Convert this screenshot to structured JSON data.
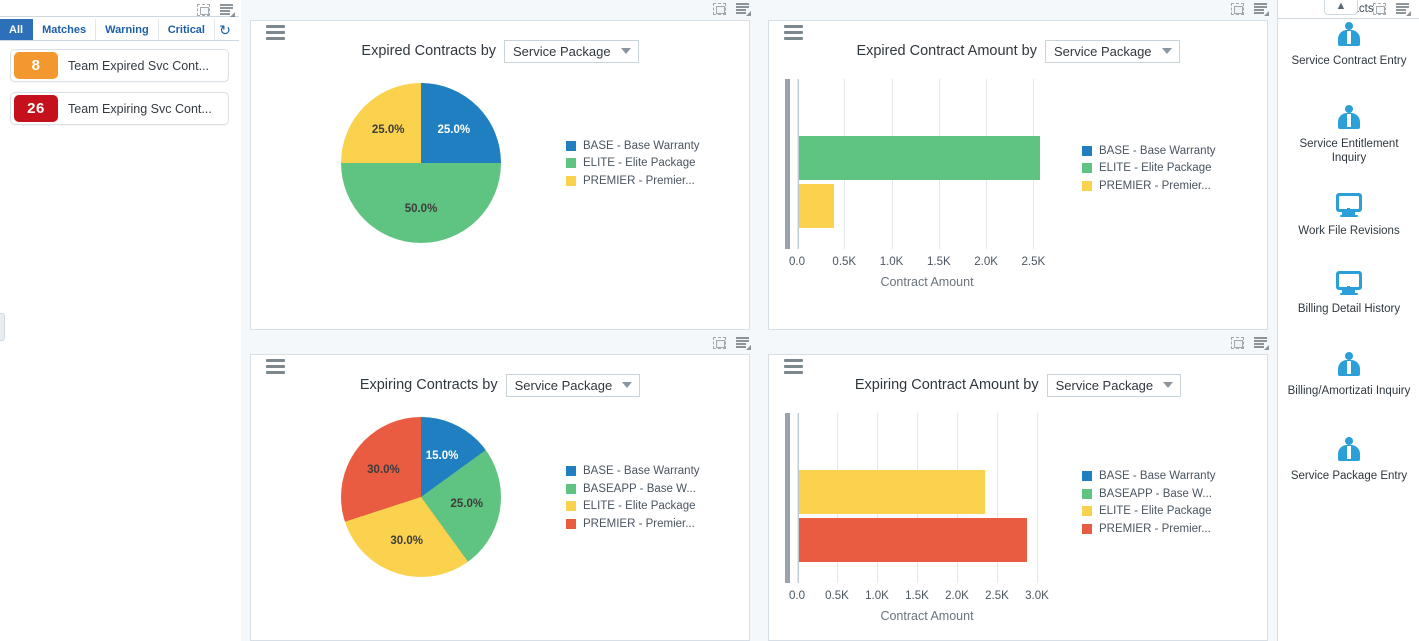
{
  "alerts_pane": {
    "tabs": [
      {
        "label": "All",
        "active": true
      },
      {
        "label": "Matches",
        "active": false
      },
      {
        "label": "Warning",
        "active": false
      },
      {
        "label": "Critical",
        "active": false
      }
    ],
    "refresh_glyph": "↻",
    "items": [
      {
        "count": "8",
        "label": "Team Expired Svc Cont...",
        "color": "#f2982f"
      },
      {
        "count": "26",
        "label": "Team Expiring Svc Cont...",
        "color": "#c4111b"
      }
    ]
  },
  "colors": {
    "base": "#1f7fc0",
    "baseapp": "#5fc481",
    "elite": "#fad24e",
    "premier": "#ea5c41",
    "elite_green": "#5fc481",
    "premier_yellow": "#fad24e"
  },
  "panels": [
    {
      "title": "Expired Contracts by",
      "dropdown": "Service Package",
      "chart_ref": 0
    },
    {
      "title": "Expired Contract Amount by",
      "dropdown": "Service Package",
      "chart_ref": 1
    },
    {
      "title": "Expiring Contracts by",
      "dropdown": "Service Package",
      "chart_ref": 2
    },
    {
      "title": "Expiring Contract Amount by",
      "dropdown": "Service Package",
      "chart_ref": 3
    }
  ],
  "chart_data": [
    {
      "type": "pie",
      "title": "Expired Contracts by Service Package",
      "categories": [
        "BASE - Base Warranty",
        "ELITE - Elite Package",
        "PREMIER - Premier..."
      ],
      "values": [
        25.0,
        50.0,
        25.0
      ],
      "data_labels": [
        "25.0%",
        "50.0%",
        "25.0%"
      ],
      "colors": [
        "#1f7fc0",
        "#5fc481",
        "#fad24e"
      ],
      "legend": [
        "BASE - Base Warranty",
        "ELITE - Elite Package",
        "PREMIER - Premier..."
      ],
      "legend_position": "right",
      "xlabel": "",
      "ylabel": ""
    },
    {
      "type": "bar",
      "orientation": "horizontal",
      "title": "Expired Contract Amount by Service Package",
      "categories": [
        "ELITE - Elite Package",
        "PREMIER - Premier..."
      ],
      "values": [
        2550,
        370
      ],
      "colors": [
        "#5fc481",
        "#fad24e"
      ],
      "legend": [
        "BASE - Base Warranty",
        "ELITE - Elite Package",
        "PREMIER - Premier..."
      ],
      "legend_colors": [
        "#1f7fc0",
        "#5fc481",
        "#fad24e"
      ],
      "legend_position": "right",
      "xlabel": "Contract Amount",
      "ylabel": "",
      "xticks": [
        "0.0",
        "0.5K",
        "1.0K",
        "1.5K",
        "2.0K",
        "2.5K"
      ],
      "xtick_values": [
        0,
        500,
        1000,
        1500,
        2000,
        2500
      ],
      "xlim": [
        0,
        2750
      ],
      "grid": true
    },
    {
      "type": "pie",
      "title": "Expiring Contracts by Service Package",
      "categories": [
        "BASE - Base Warranty",
        "BASEAPP - Base W...",
        "ELITE - Elite Package",
        "PREMIER - Premier..."
      ],
      "values": [
        15.0,
        25.0,
        30.0,
        30.0
      ],
      "data_labels": [
        "15.0%",
        "25.0%",
        "30.0%",
        "30.0%"
      ],
      "colors": [
        "#1f7fc0",
        "#5fc481",
        "#fad24e",
        "#ea5c41"
      ],
      "legend": [
        "BASE - Base Warranty",
        "BASEAPP - Base W...",
        "ELITE - Elite Package",
        "PREMIER - Premier..."
      ],
      "legend_position": "right",
      "xlabel": "",
      "ylabel": ""
    },
    {
      "type": "bar",
      "orientation": "horizontal",
      "title": "Expiring Contract Amount by Service Package",
      "categories": [
        "ELITE - Elite Package",
        "PREMIER - Premier..."
      ],
      "values": [
        2330,
        2850
      ],
      "colors": [
        "#fad24e",
        "#ea5c41"
      ],
      "legend": [
        "BASE - Base Warranty",
        "BASEAPP - Base W...",
        "ELITE - Elite Package",
        "PREMIER - Premier..."
      ],
      "legend_colors": [
        "#1f7fc0",
        "#5fc481",
        "#fad24e",
        "#ea5c41"
      ],
      "legend_position": "right",
      "xlabel": "Contract Amount",
      "ylabel": "",
      "xticks": [
        "0.0",
        "0.5K",
        "1.0K",
        "1.5K",
        "2.0K",
        "2.5K",
        "3.0K"
      ],
      "xtick_values": [
        0,
        500,
        1000,
        1500,
        2000,
        2500,
        3000
      ],
      "xlim": [
        0,
        3250
      ],
      "grid": true
    }
  ],
  "right_rail": {
    "title": "Contracts",
    "collapse_glyph": "▲",
    "items": [
      {
        "label": "Service Contract Entry",
        "icon": "person-icon"
      },
      {
        "label": "Service Entitlement Inquiry",
        "icon": "person-icon"
      },
      {
        "label": "Work File Revisions",
        "icon": "monitor-chart-icon"
      },
      {
        "label": "Billing Detail History",
        "icon": "monitor-chart-icon"
      },
      {
        "label": "Billing/Amortizati Inquiry",
        "icon": "person-icon"
      },
      {
        "label": "Service Package Entry",
        "icon": "person-icon"
      }
    ]
  }
}
